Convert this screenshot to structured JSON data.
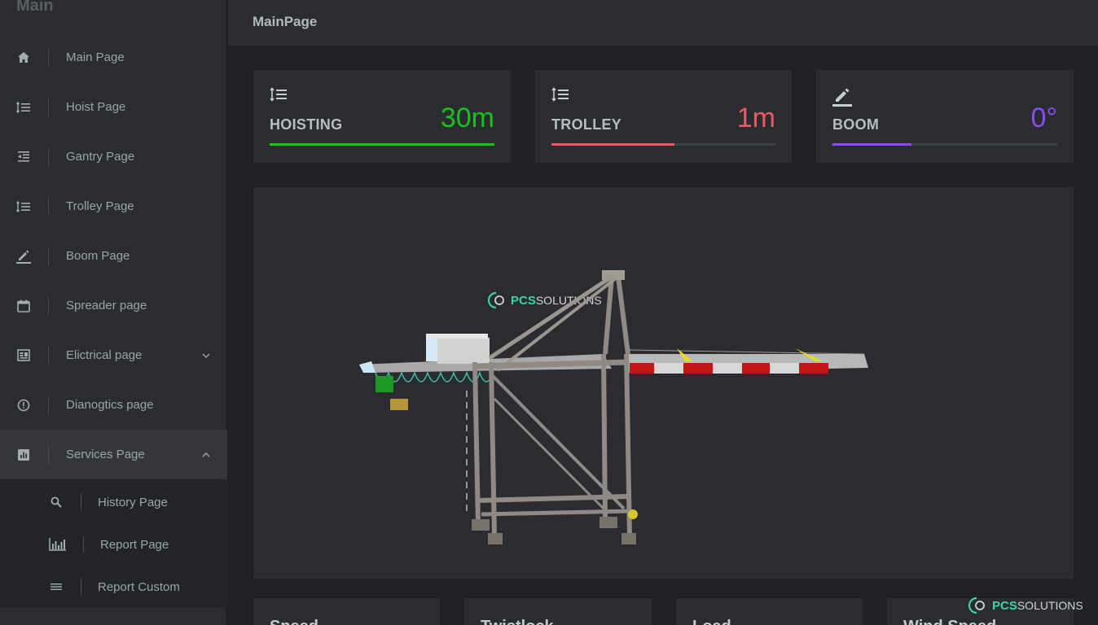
{
  "sidebar": {
    "title": "Main",
    "items": [
      {
        "label": "Main Page",
        "icon": "home-icon"
      },
      {
        "label": "Hoist Page",
        "icon": "list-ordered-icon"
      },
      {
        "label": "Gantry Page",
        "icon": "indent-icon"
      },
      {
        "label": "Trolley Page",
        "icon": "list-ordered-icon"
      },
      {
        "label": "Boom Page",
        "icon": "edit-icon"
      },
      {
        "label": "Spreader page",
        "icon": "calendar-icon"
      },
      {
        "label": "Elictrical page",
        "icon": "panel-icon"
      },
      {
        "label": "Dianogtics page",
        "icon": "alert-circle-icon"
      },
      {
        "label": "Services Page",
        "icon": "chart-box-icon"
      }
    ],
    "subitems": [
      {
        "label": "History Page",
        "icon": "search-icon"
      },
      {
        "label": "Report Page",
        "icon": "bar-chart-icon"
      },
      {
        "label": "Report Custom",
        "icon": "lines-icon"
      }
    ]
  },
  "header": {
    "title": "MainPage"
  },
  "metrics": [
    {
      "label": "HOISTING",
      "value": "30m",
      "progress": 1.0,
      "color": "#19c11b",
      "icon": "list-ordered-icon"
    },
    {
      "label": "TROLLEY",
      "value": "1m",
      "progress": 0.55,
      "color": "#e95a66",
      "icon": "list-ordered-icon"
    },
    {
      "label": "BOOM",
      "value": "0°",
      "progress": 0.35,
      "color": "#8a4df0",
      "icon": "edit-icon"
    }
  ],
  "logo": {
    "brand": "PCS",
    "sub": "SOLUTIONS"
  },
  "bottom_cards": [
    {
      "title": "Speed"
    },
    {
      "title": "Twistlock"
    },
    {
      "title": "Load"
    },
    {
      "title": "Wind Speed"
    }
  ]
}
